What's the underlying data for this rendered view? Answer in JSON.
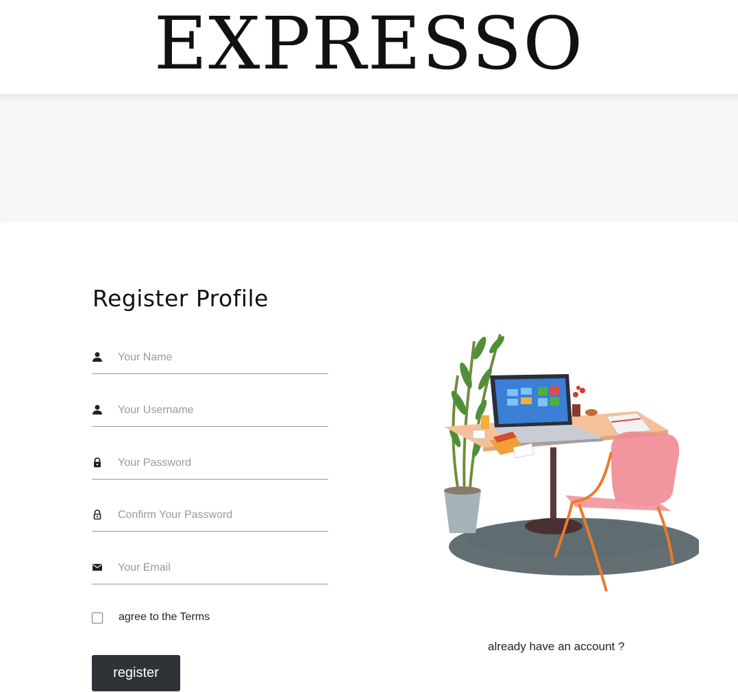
{
  "header": {
    "brand": "EXPRESSO"
  },
  "form": {
    "title": "Register Profile",
    "fields": [
      {
        "icon": "user-icon",
        "placeholder": "Your Name",
        "type": "text"
      },
      {
        "icon": "user-icon",
        "placeholder": "Your Username",
        "type": "text"
      },
      {
        "icon": "lock-icon",
        "placeholder": "Your Password",
        "type": "password"
      },
      {
        "icon": "lock-open-icon",
        "placeholder": "Confirm Your Password",
        "type": "password"
      },
      {
        "icon": "mail-icon",
        "placeholder": "Your Email",
        "type": "email"
      }
    ],
    "terms_label": "agree to the Terms",
    "submit_label": "register"
  },
  "aside": {
    "illustration": "desk-with-laptop-and-chair-illustration",
    "signin_link": "already have an account ?"
  }
}
